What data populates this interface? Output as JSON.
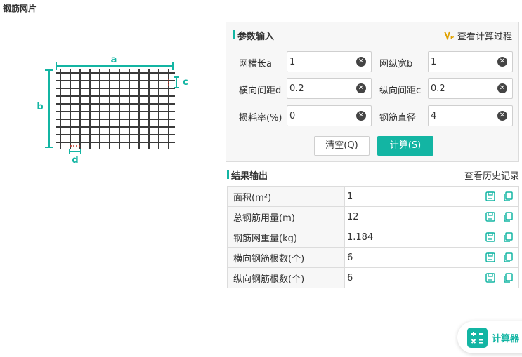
{
  "page_title": "钢筋网片",
  "colors": {
    "accent": "#13b5a3",
    "dim_red": "#c0392b",
    "grid": "#3a3a3a"
  },
  "diagram": {
    "label_a": "a",
    "label_b": "b",
    "label_c": "c",
    "label_d": "d"
  },
  "input_section": {
    "title": "参数输入",
    "process_link": "查看计算过程",
    "fields": [
      {
        "label": "网横长a",
        "value": "1"
      },
      {
        "label": "网纵宽b",
        "value": "1"
      },
      {
        "label": "横向间距d",
        "value": "0.2"
      },
      {
        "label": "纵向间距c",
        "value": "0.2"
      },
      {
        "label": "损耗率(%)",
        "value": "0"
      },
      {
        "label": "钢筋直径",
        "value": "4"
      }
    ],
    "clear_label": "清空(Q)",
    "calc_label": "计算(S)"
  },
  "result_section": {
    "title": "结果输出",
    "history_link": "查看历史记录",
    "rows": [
      {
        "label": "面积(m²)",
        "value": "1"
      },
      {
        "label": "总钢筋用量(m)",
        "value": "12"
      },
      {
        "label": "钢筋网重量(kg)",
        "value": "1.184"
      },
      {
        "label": "横向钢筋根数(个)",
        "value": "6"
      },
      {
        "label": "纵向钢筋根数(个)",
        "value": "6"
      }
    ]
  },
  "calculator_widget": {
    "label": "计算器",
    "icon": "calculator-icon"
  }
}
